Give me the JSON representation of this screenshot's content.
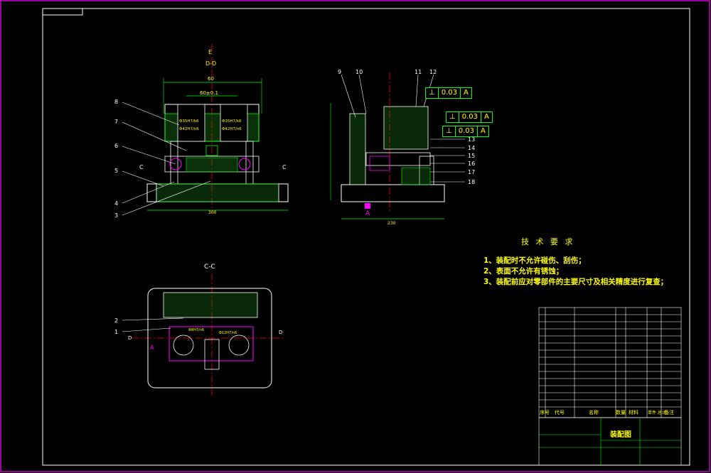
{
  "views": {
    "front_label_top": "D-D",
    "front_label_e": "E",
    "section_cc": "C-C",
    "section_c_left": "C",
    "section_c_right": "C",
    "dim_width": "60",
    "dim_pitch": "60±0.1",
    "dim_base": "300",
    "dim_side_base": "230",
    "fit_1": "Φ35H7/k6",
    "fit_2": "Φ42H7/n6",
    "fit_3": "Φ35H7/k6",
    "fit_4": "Φ42H7/n6",
    "cc_fit_1": "Φ8H7/n6",
    "cc_fit_2": "Φ12H7/n6",
    "cc_mark": "A",
    "cc_d_left": "D",
    "cc_d_right": "D"
  },
  "callouts_front": [
    "8",
    "7",
    "6",
    "5",
    "4",
    "3"
  ],
  "callouts_side": [
    "9",
    "10",
    "11",
    "12",
    "13",
    "14",
    "15",
    "16",
    "17",
    "18"
  ],
  "callouts_section": [
    "2",
    "1"
  ],
  "datum_mark": "A",
  "tolerances": [
    {
      "symbol": "⊥",
      "value": "0.03",
      "datum": "A"
    },
    {
      "symbol": "⊥",
      "value": "0.03",
      "datum": "A"
    },
    {
      "symbol": "⊥",
      "value": "0.03",
      "datum": "A"
    }
  ],
  "tech_requirements": {
    "title": "技 术 要 求",
    "items": [
      "1、装配时不允许碰伤、刮伤；",
      "2、表面不允许有锈蚀；",
      "3、装配前应对零部件的主要尺寸及相关精度进行复查；"
    ]
  },
  "title_block": {
    "drawing_title": "装配图",
    "col_seq": "序号",
    "col_code": "代号",
    "col_name": "名称",
    "col_qty": "数量",
    "col_material": "材料",
    "col_weight": "单件 总计",
    "col_note": "备注"
  }
}
